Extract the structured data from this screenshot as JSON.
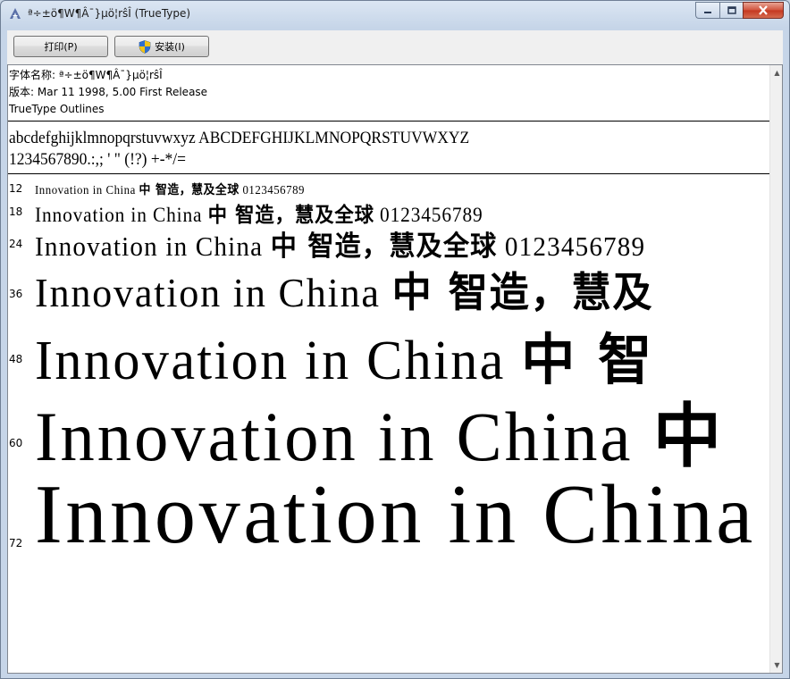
{
  "window": {
    "title": "ª÷±ö¶W¶Â¯}µö¦rŝÎ (TrueType)",
    "buttons": {
      "minimize": "minimize",
      "maximize": "maximize",
      "close": "close"
    }
  },
  "toolbar": {
    "print_label": "打印(P)",
    "install_label": "安装(I)"
  },
  "info": {
    "font_name": "字体名称: ª÷±ö¶W¶Â¯}µö¦rŝÎ",
    "version": "版本: Mar 11 1998, 5.00 First Release",
    "outline": "TrueType Outlines"
  },
  "charset": {
    "line1": "abcdefghijklmnopqrstuvwxyz ABCDEFGHIJKLMNOPQRSTUVWXYZ",
    "line2": "1234567890.:,; ' \" (!?) +-*/="
  },
  "samples": [
    {
      "size": "12",
      "latin": "Innovation in China ",
      "cjk": "中  智造，慧及全球",
      "digits": " 0123456789"
    },
    {
      "size": "18",
      "latin": "Innovation in China ",
      "cjk": "中  智造，慧及全球",
      "digits": " 0123456789"
    },
    {
      "size": "24",
      "latin": "Innovation in China ",
      "cjk": "中  智造，慧及全球",
      "digits": " 0123456789"
    },
    {
      "size": "36",
      "latin": "Innovation in China ",
      "cjk": "中  智造，慧及",
      "digits": ""
    },
    {
      "size": "48",
      "latin": "Innovation in China ",
      "cjk": "中  智",
      "digits": ""
    },
    {
      "size": "60",
      "latin": "Innovation in China ",
      "cjk": "中",
      "digits": ""
    },
    {
      "size": "72",
      "latin": "Innovation in China",
      "cjk": "",
      "digits": ""
    }
  ],
  "colors": {
    "frame": "#c6d5e8",
    "close_button": "#c5371f",
    "content_bg": "#ffffff"
  }
}
